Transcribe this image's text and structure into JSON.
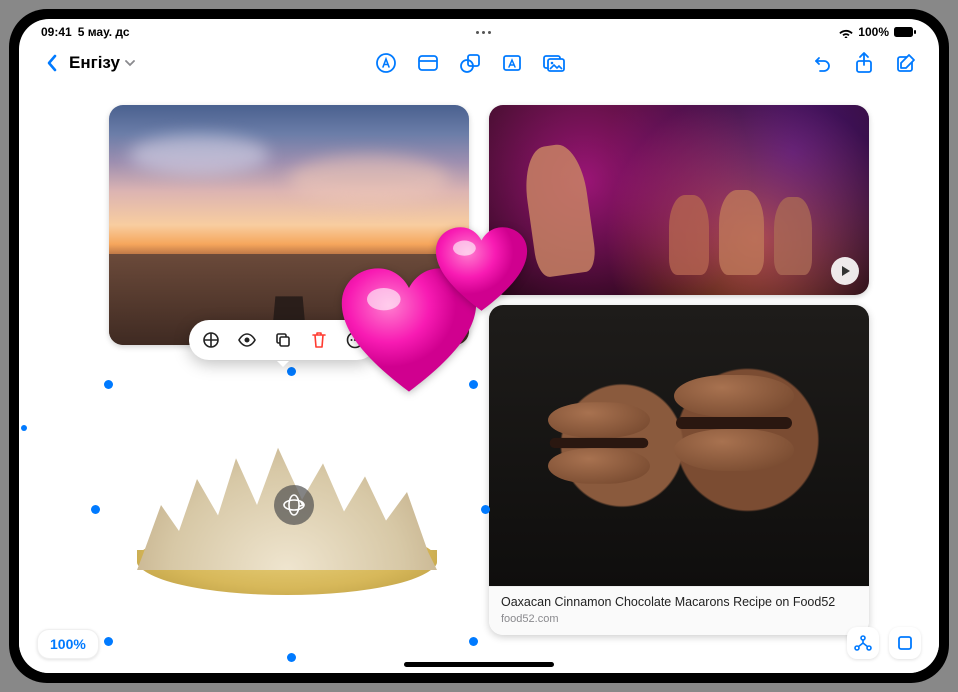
{
  "status": {
    "time": "09:41",
    "date": "5 мау. дс",
    "battery": "100%"
  },
  "toolbar": {
    "back_title": "Енгізу"
  },
  "selection_toolbar": {
    "items": [
      "crop",
      "view",
      "copy",
      "delete",
      "more"
    ]
  },
  "link_card": {
    "title": "Oaxacan Cinnamon Chocolate Macarons Recipe on Food52",
    "domain": "food52.com"
  },
  "zoom": {
    "level": "100%"
  },
  "accent": "#007aff",
  "danger": "#ff3b30"
}
